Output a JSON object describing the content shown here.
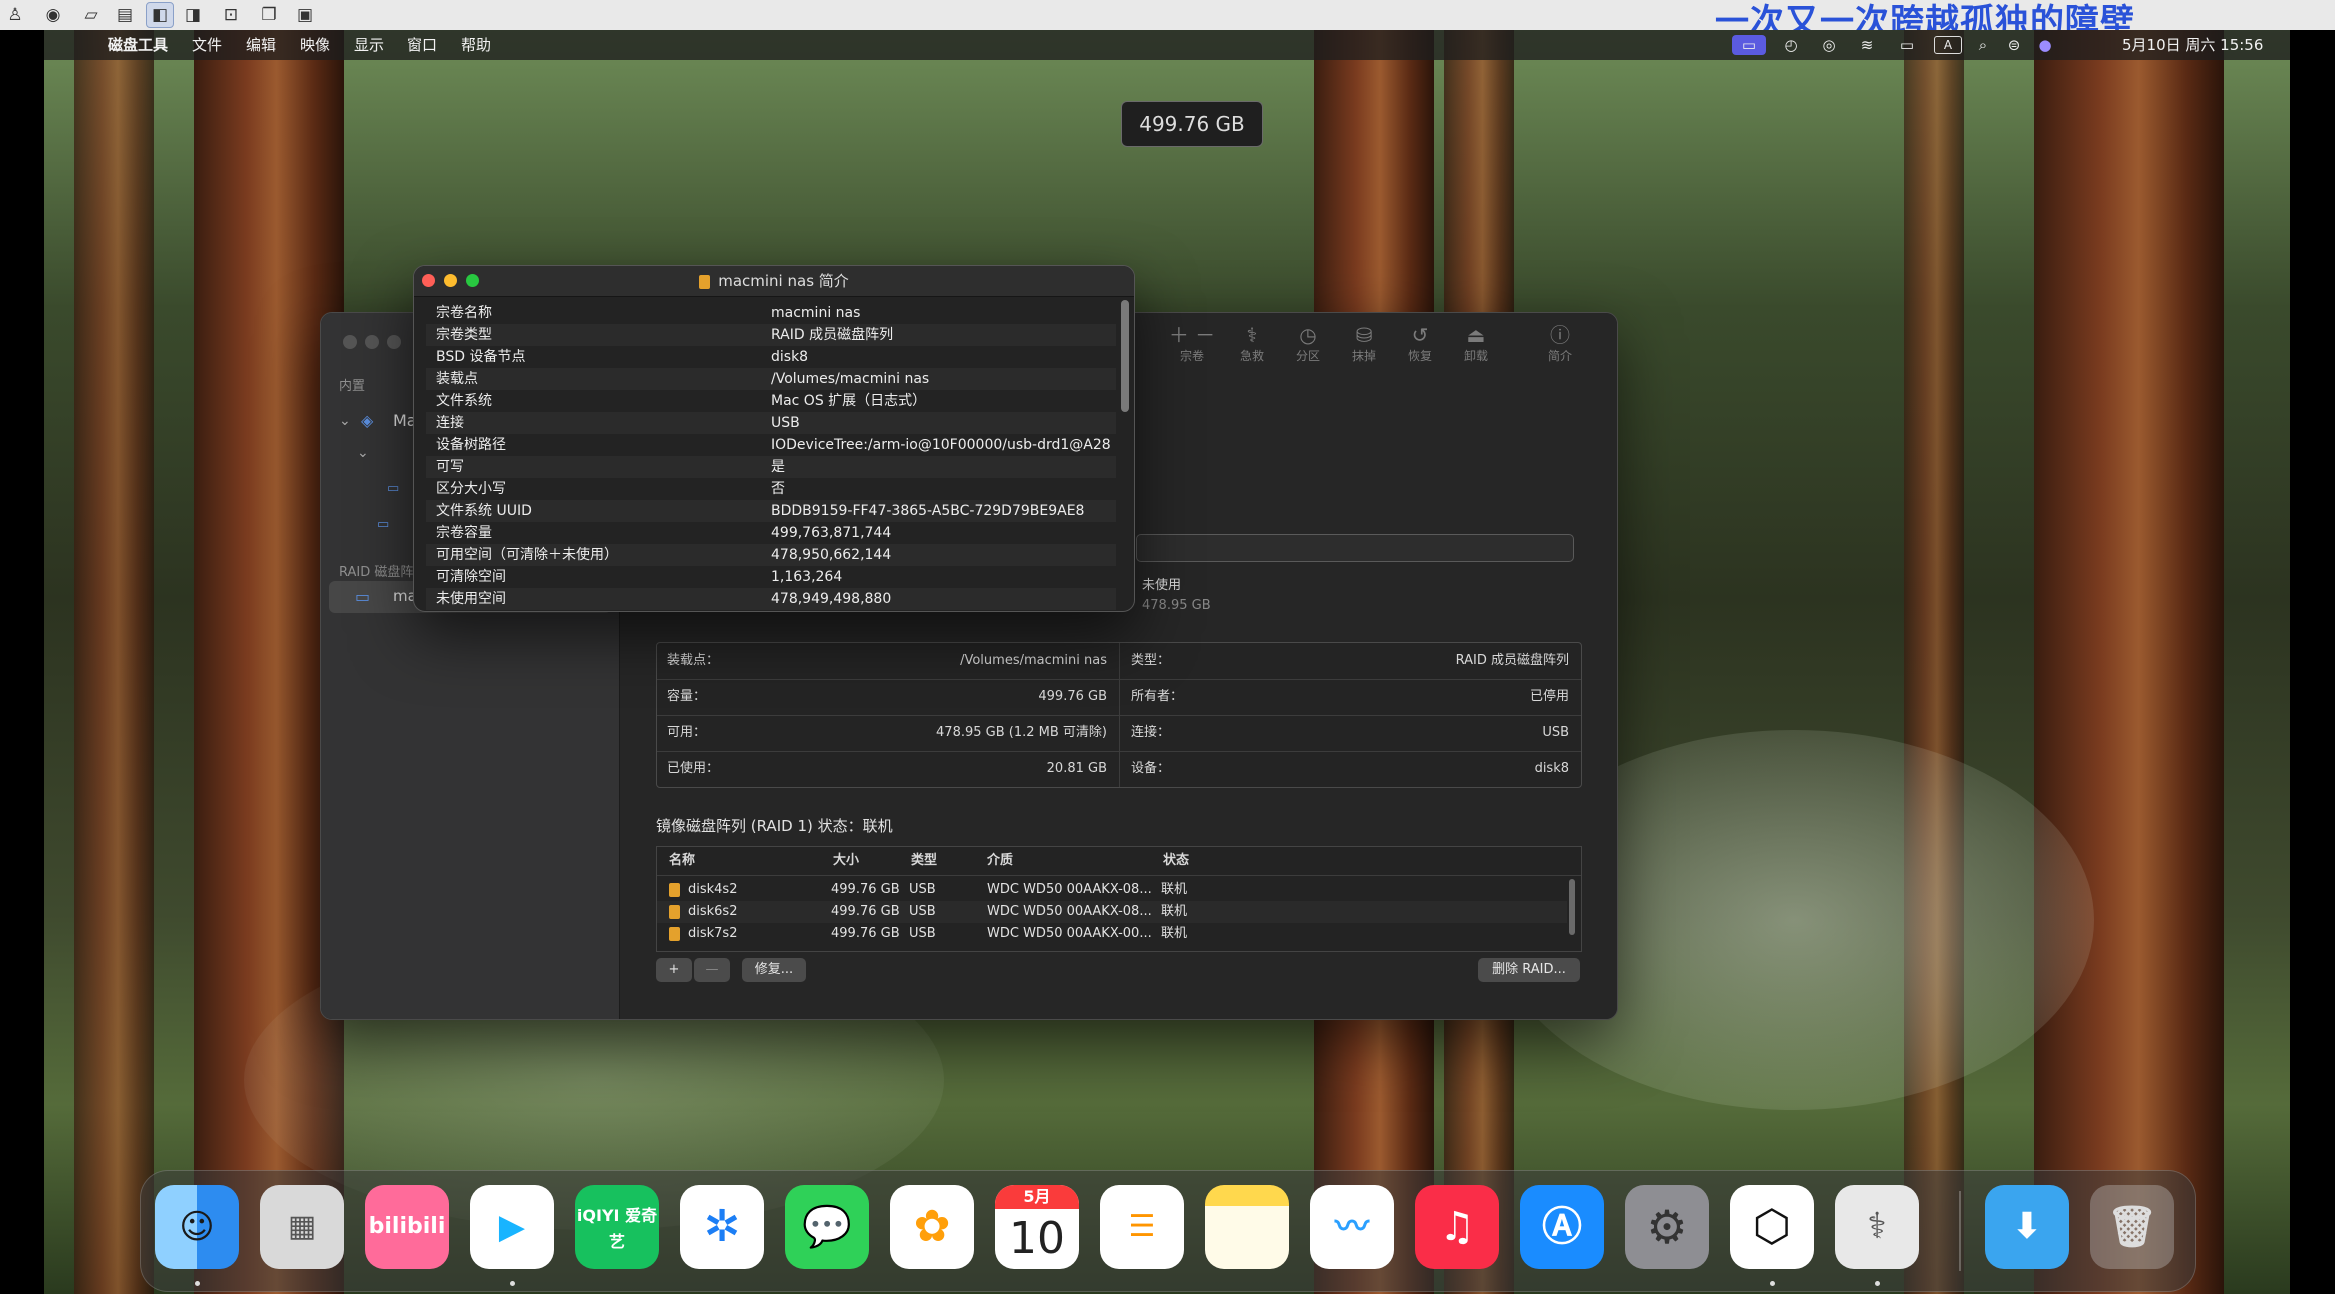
{
  "caption": "一次又一次跨越孤独的障壁",
  "menubar": {
    "app_name": "磁盘工具",
    "items": [
      "文件",
      "编辑",
      "映像",
      "显示",
      "窗口",
      "帮助"
    ],
    "datetime": "5月10日 周六 15:56",
    "status_icons": [
      "screen-mirroring-icon",
      "timer-icon",
      "vpn-icon",
      "wifi-icon",
      "battery-icon",
      "input-method-icon",
      "search-icon",
      "control-center-icon",
      "siri-icon"
    ]
  },
  "disk_utility": {
    "sidebar": {
      "internal_label": "内置",
      "raid_label": "RAID 磁盘阵列",
      "item_partial": "Ma",
      "raid_item_partial": "ma"
    },
    "toolbar": [
      "宗卷",
      "急救",
      "分区",
      "抹掉",
      "恢复",
      "卸载",
      "简介"
    ],
    "size_display": "499.76 GB",
    "usage": {
      "label": "未使用",
      "value": "478.95 GB"
    },
    "info_table": {
      "left": [
        {
          "label": "装载点：",
          "value": "/Volumes/macmini nas"
        },
        {
          "label": "容量：",
          "value": "499.76 GB"
        },
        {
          "label": "可用：",
          "value": "478.95 GB (1.2 MB 可清除)"
        },
        {
          "label": "已使用：",
          "value": "20.81 GB"
        }
      ],
      "right": [
        {
          "label": "类型：",
          "value": "RAID 成员磁盘阵列"
        },
        {
          "label": "所有者：",
          "value": "已停用"
        },
        {
          "label": "连接：",
          "value": "USB"
        },
        {
          "label": "设备：",
          "value": "disk8"
        }
      ]
    },
    "raid_status": "镜像磁盘阵列 (RAID 1) 状态：联机",
    "raid_columns": [
      "名称",
      "大小",
      "类型",
      "介质",
      "状态"
    ],
    "raid_rows": [
      {
        "name": "disk4s2",
        "size": "499.76 GB",
        "type": "USB",
        "media": "WDC WD50 00AAKX-08...",
        "status": "联机"
      },
      {
        "name": "disk6s2",
        "size": "499.76 GB",
        "type": "USB",
        "media": "WDC WD50 00AAKX-08...",
        "status": "联机"
      },
      {
        "name": "disk7s2",
        "size": "499.76 GB",
        "type": "USB",
        "media": "WDC WD50 00AAKX-00...",
        "status": "联机"
      }
    ],
    "buttons": {
      "add": "+",
      "remove": "—",
      "repair": "修复...",
      "delete_raid": "删除 RAID..."
    }
  },
  "info_window": {
    "title": "macmini nas 简介",
    "rows": [
      {
        "key": "宗卷名称",
        "value": "macmini nas"
      },
      {
        "key": "宗卷类型",
        "value": "RAID 成员磁盘阵列"
      },
      {
        "key": "BSD 设备节点",
        "value": "disk8"
      },
      {
        "key": "装载点",
        "value": "/Volumes/macmini nas"
      },
      {
        "key": "文件系统",
        "value": "Mac OS 扩展（日志式）"
      },
      {
        "key": "连接",
        "value": "USB"
      },
      {
        "key": "设备树路径",
        "value": "IODeviceTree:/arm-io@10F00000/usb-drd1@A28"
      },
      {
        "key": "可写",
        "value": "是"
      },
      {
        "key": "区分大小写",
        "value": "否"
      },
      {
        "key": "文件系统 UUID",
        "value": "BDDB9159-FF47-3865-A5BC-729D79BE9AE8"
      },
      {
        "key": "宗卷容量",
        "value": "499,763,871,744"
      },
      {
        "key": "可用空间（可清除＋未使用）",
        "value": "478,950,662,144"
      },
      {
        "key": "可清除空间",
        "value": "1,163,264"
      },
      {
        "key": "未使用空间",
        "value": "478,949,498,880"
      }
    ]
  },
  "dock": {
    "apps": [
      {
        "name": "finder-icon",
        "label": ""
      },
      {
        "name": "launchpad-icon",
        "label": ""
      },
      {
        "name": "bilibili-icon",
        "label": "bilibili"
      },
      {
        "name": "video-player-icon",
        "label": ""
      },
      {
        "name": "iqiyi-icon",
        "label": "iQIYI 爱奇艺"
      },
      {
        "name": "safari-icon",
        "label": ""
      },
      {
        "name": "messages-icon",
        "label": ""
      },
      {
        "name": "photos-icon",
        "label": ""
      },
      {
        "name": "calendar-icon",
        "month": "5月",
        "day": "10"
      },
      {
        "name": "reminders-icon",
        "label": ""
      },
      {
        "name": "notes-icon",
        "label": ""
      },
      {
        "name": "freeform-icon",
        "label": ""
      },
      {
        "name": "music-icon",
        "label": ""
      },
      {
        "name": "app-store-icon",
        "label": ""
      },
      {
        "name": "system-settings-icon",
        "label": ""
      },
      {
        "name": "chatgpt-icon",
        "label": ""
      },
      {
        "name": "disk-utility-icon",
        "label": ""
      },
      {
        "name": "downloads-folder-icon",
        "label": ""
      },
      {
        "name": "trash-icon",
        "label": ""
      }
    ]
  },
  "colors": {
    "accent_blue": "#2a52d8",
    "disk_orange": "#e4a12c"
  }
}
